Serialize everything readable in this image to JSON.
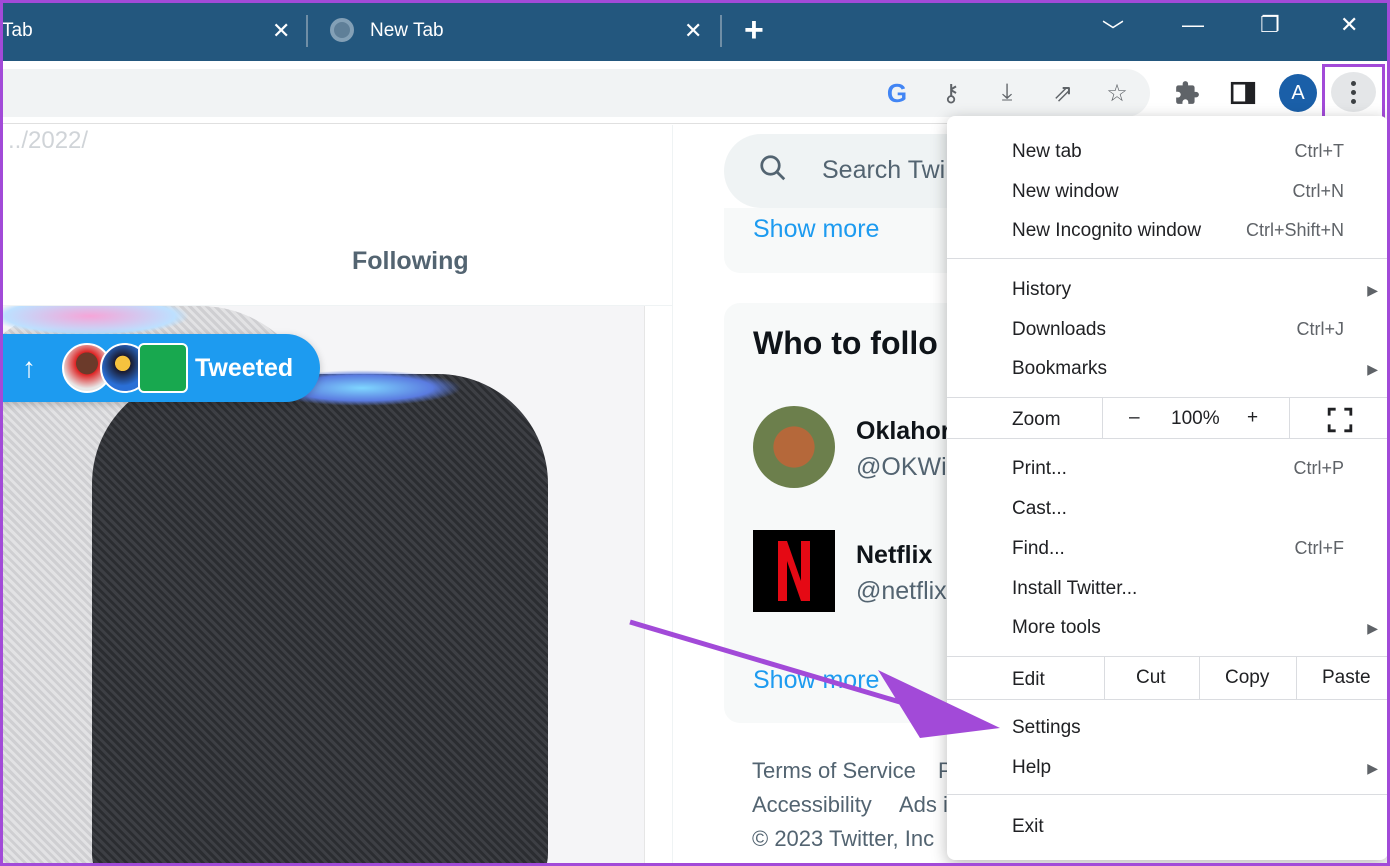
{
  "tabs": [
    {
      "title": "Tab",
      "close": "✕"
    },
    {
      "title": "New Tab",
      "close": "✕"
    }
  ],
  "titlebar": {
    "new_tab": "+",
    "tab_search": "﹀",
    "minimize": "—",
    "restore": "❐",
    "close": "✕"
  },
  "toolbar": {
    "google_icon": "G",
    "key_icon": "⚷",
    "install_icon": "⤓",
    "share_icon": "⇗",
    "star_icon": "☆",
    "extensions_icon": "✚",
    "sidepanel_icon": "▮",
    "profile_initial": "A"
  },
  "page": {
    "url_ghost": "../2022/",
    "following_tab": "Following",
    "tweeted_label": "Tweeted",
    "tweeted_arrow": "↑",
    "search_placeholder": "Search Twi",
    "show_more_1": "Show more",
    "who_to_follow": "Who to follo",
    "accounts": [
      {
        "name": "Oklahor",
        "handle": "@OKWi"
      },
      {
        "name": "Netflix",
        "handle": "@netflix"
      }
    ],
    "show_more_2": "Show more",
    "footer": {
      "terms": "Terms of Service",
      "p": "P",
      "accessibility": "Accessibility",
      "ads": "Ads i",
      "copyright": "© 2023 Twitter, Inc"
    }
  },
  "menu": {
    "new_tab": "New tab",
    "new_tab_sc": "Ctrl+T",
    "new_window": "New window",
    "new_window_sc": "Ctrl+N",
    "incognito": "New Incognito window",
    "incognito_sc": "Ctrl+Shift+N",
    "history": "History",
    "downloads": "Downloads",
    "downloads_sc": "Ctrl+J",
    "bookmarks": "Bookmarks",
    "zoom": "Zoom",
    "zoom_minus": "–",
    "zoom_value": "100%",
    "zoom_plus": "+",
    "print": "Print...",
    "print_sc": "Ctrl+P",
    "cast": "Cast...",
    "find": "Find...",
    "find_sc": "Ctrl+F",
    "install": "Install Twitter...",
    "more_tools": "More tools",
    "edit": "Edit",
    "cut": "Cut",
    "copy": "Copy",
    "paste": "Paste",
    "settings": "Settings",
    "help": "Help",
    "exit": "Exit",
    "submenu_arrow": "▶"
  },
  "colors": {
    "accent_highlight": "#a24ad8",
    "twitter_blue": "#1d9bf0",
    "titlebar": "#23577e"
  }
}
